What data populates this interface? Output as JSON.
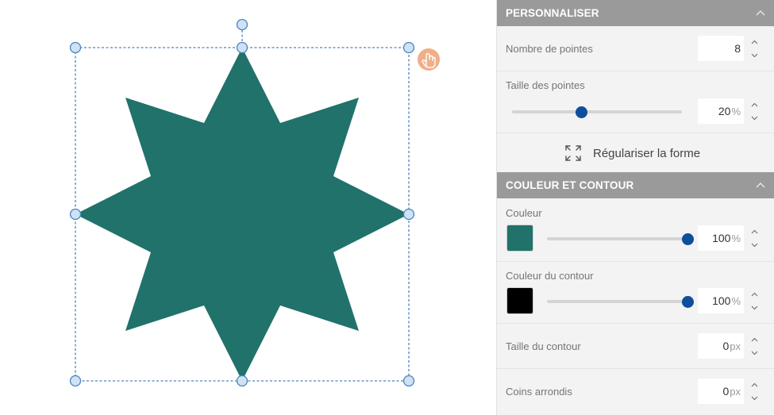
{
  "colors": {
    "star_fill": "#20726a",
    "handle_fill": "#cfe2f3",
    "handle_stroke": "#4a84c1",
    "selection_stroke": "#4a84c1",
    "cursor_badge": "#f0a57a",
    "header_bg": "#9a9a9a",
    "slider_thumb": "#0f4e9b",
    "stroke_color": "#000000"
  },
  "canvas": {
    "shape": "star-8-points",
    "cursor_icon": "hand-pointer-icon"
  },
  "panel": {
    "personnaliser": {
      "title": "PERSONNALISER",
      "nombre_label": "Nombre de pointes",
      "nombre_value": "8",
      "taille_label": "Taille des pointes",
      "taille_value": "20",
      "taille_unit": "%",
      "taille_level": 0.41,
      "regulariser_label": "Régulariser la forme"
    },
    "couleur_contour": {
      "title": "COULEUR ET CONTOUR",
      "couleur_label": "Couleur",
      "couleur_value": "100",
      "couleur_unit": "%",
      "couleur_level": 1.0,
      "contour_color_label": "Couleur du contour",
      "contour_color_value": "100",
      "contour_color_unit": "%",
      "contour_color_level": 1.0,
      "taille_contour_label": "Taille du contour",
      "taille_contour_value": "0",
      "taille_contour_unit": "px",
      "coins_label": "Coins arrondis",
      "coins_value": "0",
      "coins_unit": "px"
    }
  }
}
